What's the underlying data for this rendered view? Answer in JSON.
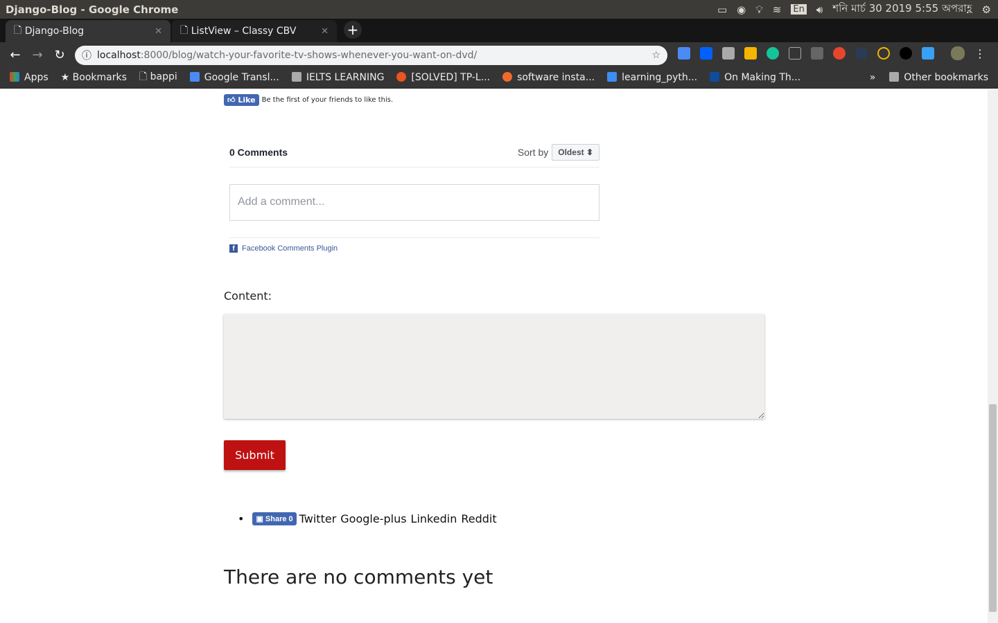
{
  "window": {
    "title": "Django-Blog - Google Chrome"
  },
  "tray": {
    "lang": "En",
    "datetime": "শনি মার্চ 30 2019  5:55 অপরাহ্ণ"
  },
  "tabs": [
    {
      "label": "Django-Blog"
    },
    {
      "label": "ListView – Classy CBV"
    }
  ],
  "address": {
    "host": "localhost",
    "path": ":8000/blog/watch-your-favorite-tv-shows-whenever-you-want-on-dvd/"
  },
  "bookmarks": [
    {
      "label": "Apps"
    },
    {
      "label": "Bookmarks"
    },
    {
      "label": "bappi"
    },
    {
      "label": "Google Transl..."
    },
    {
      "label": "IELTS LEARNING"
    },
    {
      "label": "[SOLVED] TP-L..."
    },
    {
      "label": "software insta..."
    },
    {
      "label": "learning_pyth..."
    },
    {
      "label": "On Making Th..."
    }
  ],
  "bookmarks_more": "»",
  "other_bookmarks": "Other bookmarks",
  "fb_like": {
    "button": "Like",
    "text": "Be the first of your friends to like this."
  },
  "fb_comments": {
    "count": "0 Comments",
    "sort_label": "Sort by",
    "sort_value": "Oldest ⬍",
    "placeholder": "Add a comment...",
    "plugin": "Facebook Comments Plugin"
  },
  "form": {
    "content_label": "Content:",
    "submit": "Submit"
  },
  "share": {
    "facebook": "Share 0",
    "links": [
      "Twitter",
      "Google-plus",
      "Linkedin",
      "Reddit"
    ]
  },
  "no_comments": "There are no comments yet"
}
